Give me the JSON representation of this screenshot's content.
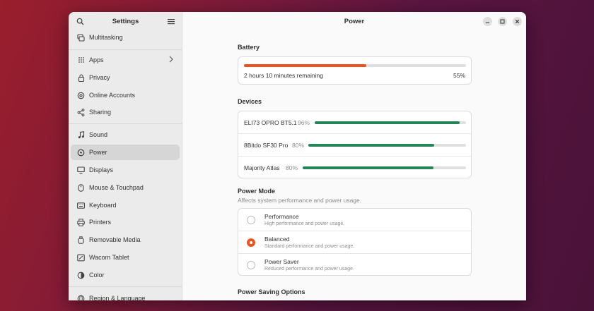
{
  "sidebar": {
    "title": "Settings",
    "items": [
      {
        "label": "Multitasking",
        "icon": "multitasking-icon"
      },
      {
        "label": "Apps",
        "icon": "apps-grid-icon"
      },
      {
        "label": "Privacy",
        "icon": "lock-icon"
      },
      {
        "label": "Online Accounts",
        "icon": "online-accounts-icon"
      },
      {
        "label": "Sharing",
        "icon": "share-icon"
      },
      {
        "label": "Sound",
        "icon": "music-note-icon"
      },
      {
        "label": "Power",
        "icon": "power-icon"
      },
      {
        "label": "Displays",
        "icon": "monitor-icon"
      },
      {
        "label": "Mouse & Touchpad",
        "icon": "mouse-icon"
      },
      {
        "label": "Keyboard",
        "icon": "keyboard-icon"
      },
      {
        "label": "Printers",
        "icon": "printer-icon"
      },
      {
        "label": "Removable Media",
        "icon": "removable-media-icon"
      },
      {
        "label": "Wacom Tablet",
        "icon": "tablet-icon"
      },
      {
        "label": "Color",
        "icon": "color-icon"
      },
      {
        "label": "Region & Language",
        "icon": "globe-icon"
      }
    ],
    "active": "Power"
  },
  "main": {
    "title": "Power",
    "battery": {
      "section_title": "Battery",
      "remaining_text": "2 hours 10 minutes remaining",
      "percent_label": "55%",
      "level": 0.55
    },
    "devices": {
      "section_title": "Devices",
      "items": [
        {
          "name": "ELI73 OPRO BT5.1",
          "percent_label": "96%",
          "level": 0.96
        },
        {
          "name": "8Bitdo SF30 Pro",
          "percent_label": "80%",
          "level": 0.8
        },
        {
          "name": "Majority Atlas",
          "percent_label": "80%",
          "level": 0.8
        }
      ]
    },
    "power_mode": {
      "section_title": "Power Mode",
      "subtitle": "Affects system performance and power usage.",
      "options": [
        {
          "title": "Performance",
          "desc": "High performance and power usage."
        },
        {
          "title": "Balanced",
          "desc": "Standard performance and power usage."
        },
        {
          "title": "Power Saver",
          "desc": "Reduced performance and power usage."
        }
      ],
      "selected": "Balanced"
    },
    "power_saving": {
      "section_title": "Power Saving Options"
    }
  },
  "colors": {
    "accent": "#e95420",
    "device_bar": "#26845b",
    "track": "#e0e0e0"
  }
}
